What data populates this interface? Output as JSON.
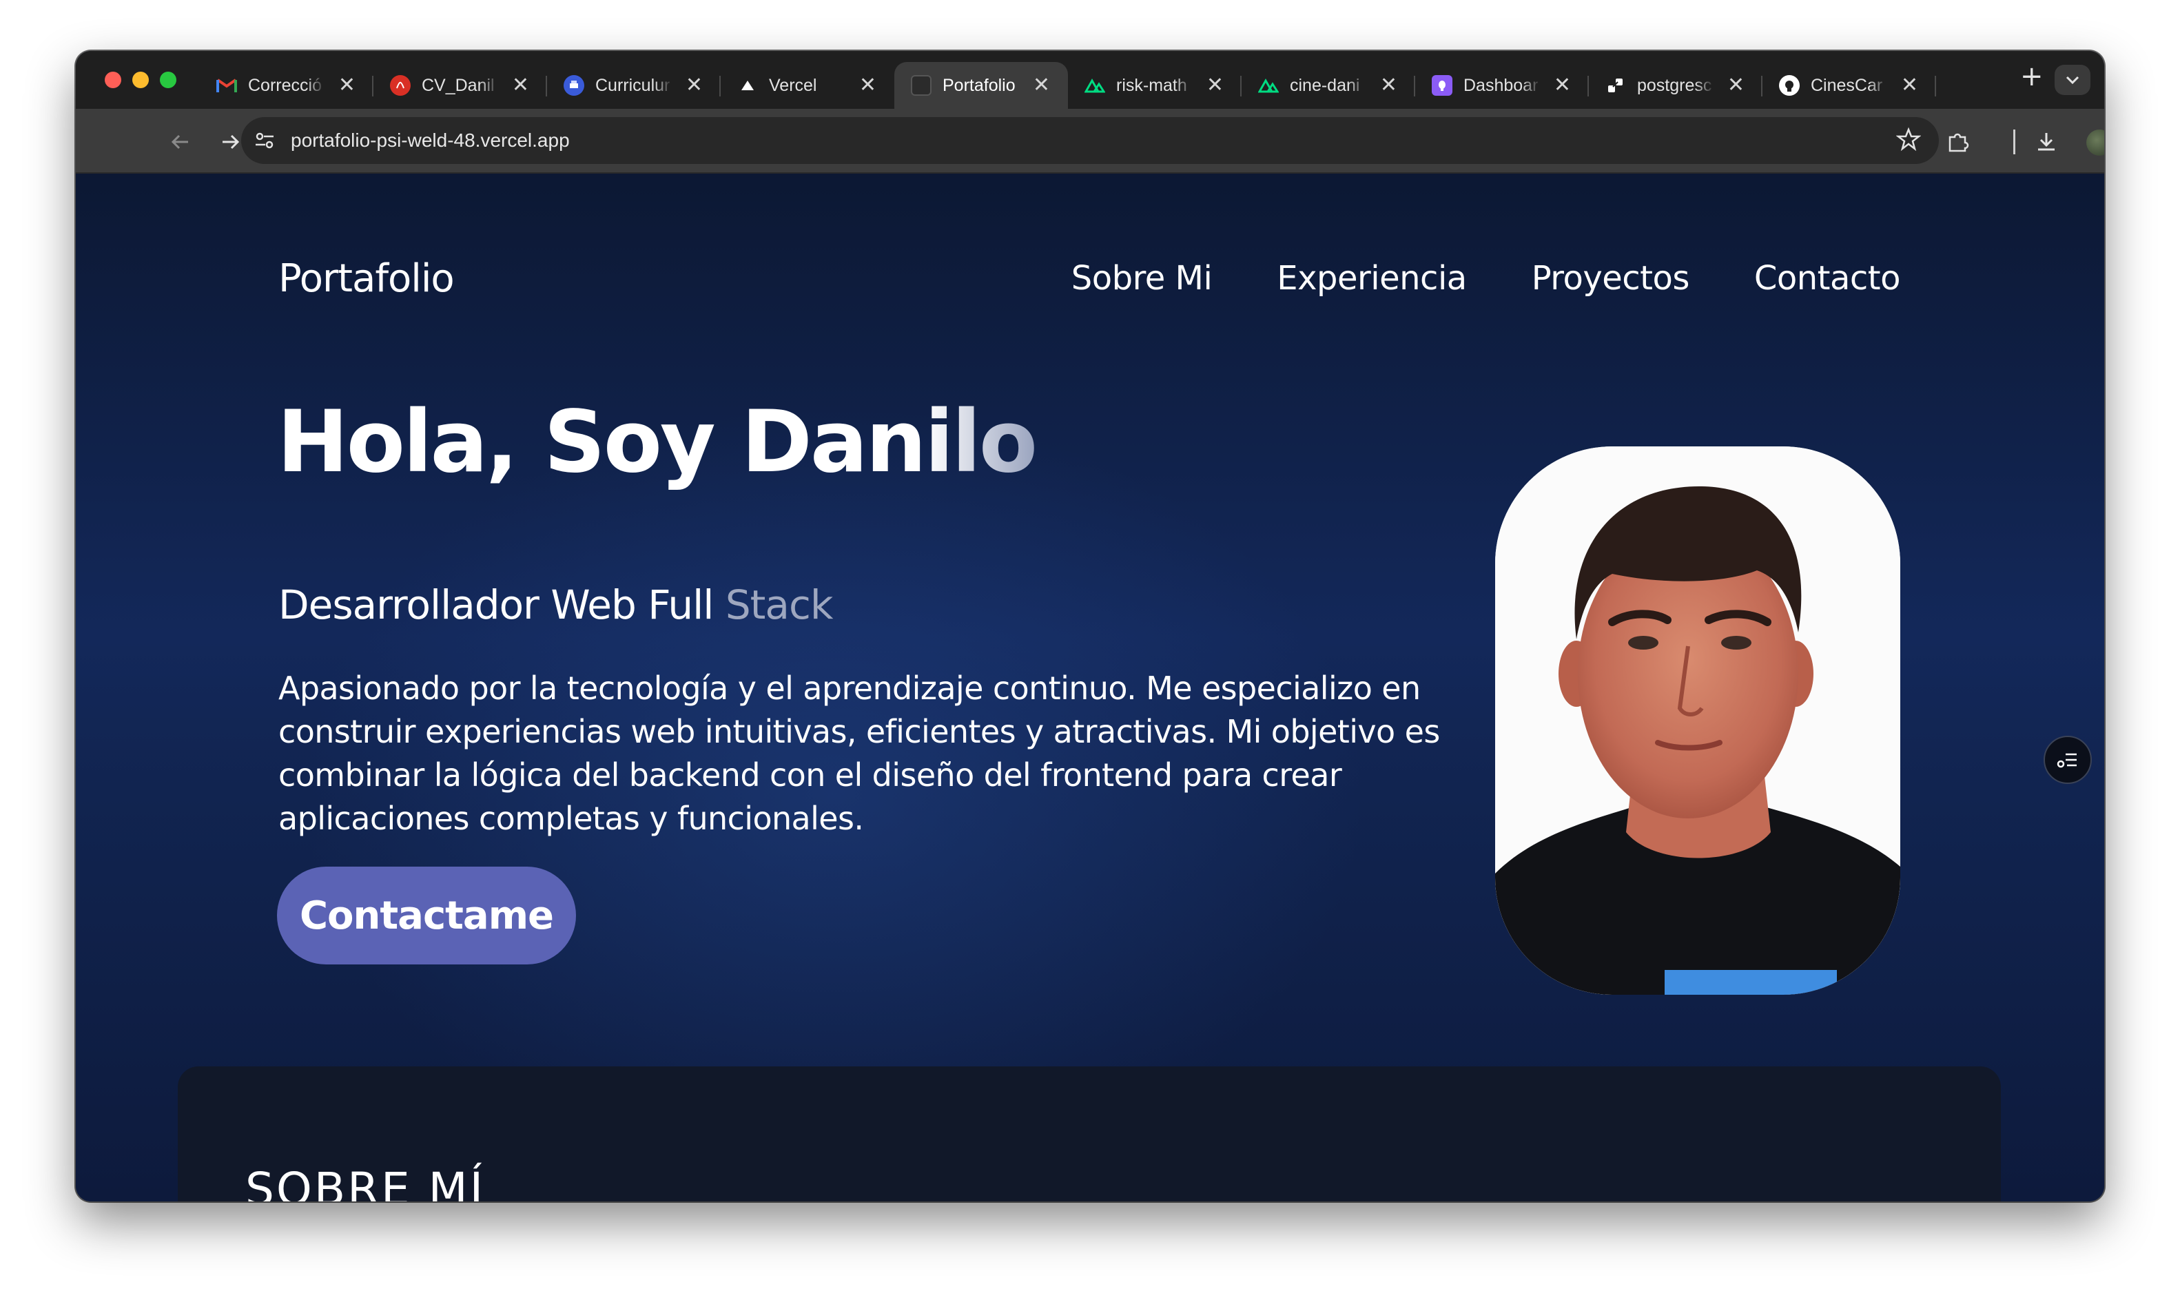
{
  "browser": {
    "tabs": [
      {
        "title": "Correcció",
        "icon": "gmail-icon"
      },
      {
        "title": "CV_Danil",
        "icon": "pdf-icon"
      },
      {
        "title": "Curriculur",
        "icon": "printer-icon"
      },
      {
        "title": "Vercel",
        "icon": "vercel-icon"
      },
      {
        "title": "Portafolio",
        "icon": "site-icon",
        "active": true
      },
      {
        "title": "risk-math",
        "icon": "nuxt-icon"
      },
      {
        "title": "cine-dani",
        "icon": "nuxt-icon"
      },
      {
        "title": "Dashboar",
        "icon": "dashboard-icon"
      },
      {
        "title": "postgresc",
        "icon": "postgres-icon"
      },
      {
        "title": "CinesCar",
        "icon": "github-icon"
      }
    ],
    "new_tab_symbol": "+",
    "close_symbol": "✕",
    "url": "portafolio-psi-weld-48.vercel.app"
  },
  "nav": {
    "logo": "Portafolio",
    "links": [
      "Sobre Mi",
      "Experiencia",
      "Proyectos",
      "Contacto"
    ]
  },
  "hero": {
    "title_main": "Hola, Soy Dan",
    "title_fade": "ilo",
    "subtitle_main": "Desarrollador Web Full ",
    "subtitle_fade": "Stack",
    "description": "Apasionado por la tecnología y el aprendizaje continuo. Me especializo en construir experiencias web intuitivas, eficientes y atractivas. Mi objetivo es combinar la lógica del backend con el diseño del frontend para crear aplicaciones completas y funcionales.",
    "cta": "Contactame"
  },
  "about": {
    "heading": "SOBRE MÍ"
  },
  "colors": {
    "accent_button": "#5b63b5",
    "page_bg": "#13285a",
    "card_bg": "#111829"
  }
}
